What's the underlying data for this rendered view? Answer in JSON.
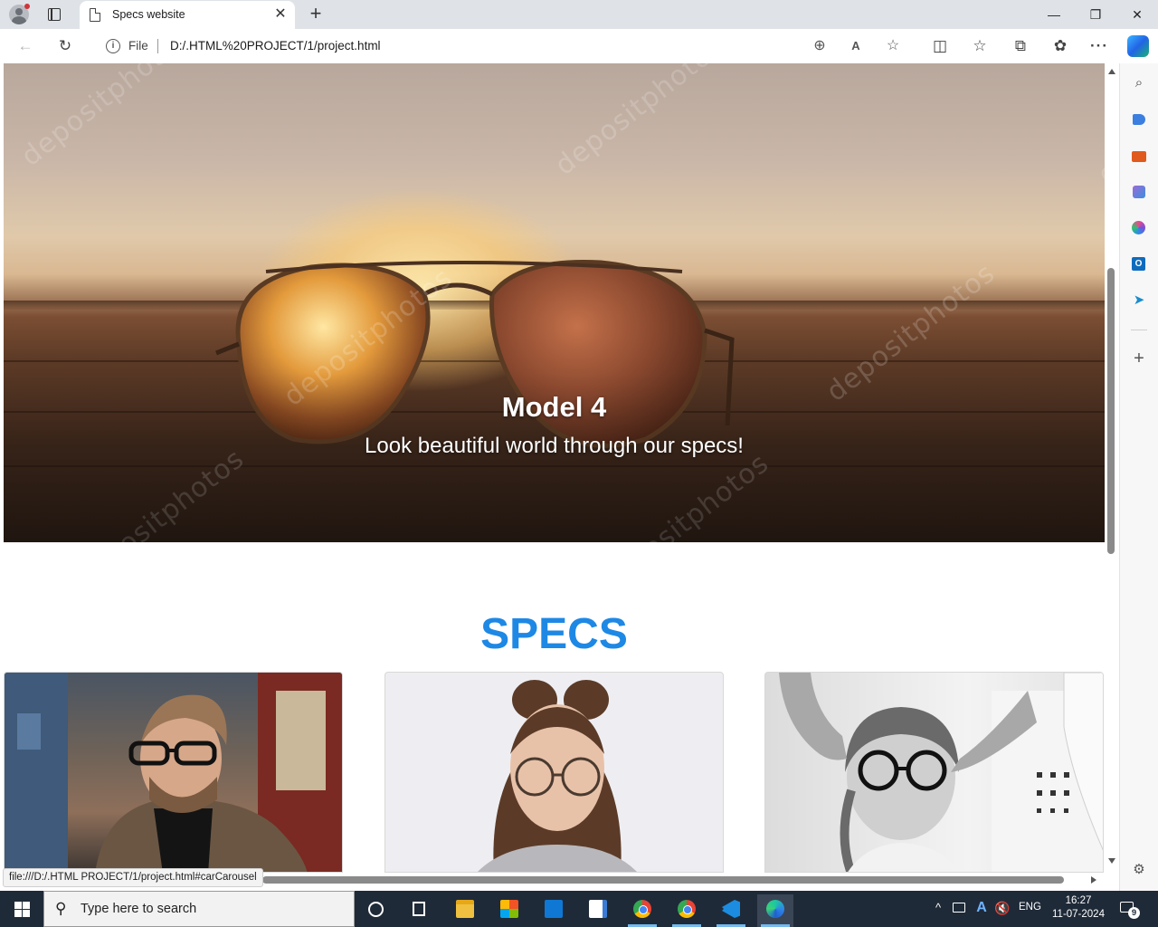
{
  "browser": {
    "tab_title": "Specs website",
    "tab_close_glyph": "✕",
    "new_tab_glyph": "+",
    "address": {
      "scheme_label": "File",
      "url": "D:/.HTML%20PROJECT/1/project.html"
    },
    "window_controls": {
      "minimize": "—",
      "restore": "❐",
      "close": "✕"
    },
    "toolbar_glyphs": {
      "back": "←",
      "reload": "↻",
      "zoom": "⊕",
      "read_aloud": "A",
      "favorite": "☆",
      "split_screen": "◫",
      "favorites": "☆",
      "collections": "⧉",
      "extensions": "✿",
      "more": "···"
    },
    "status_url": "file:///D:/.HTML PROJECT/1/project.html#carCarousel"
  },
  "sidebar": {
    "search_glyph": "⌕",
    "send_glyph": "➤",
    "add_glyph": "+",
    "settings_glyph": "⚙",
    "outlook_letter": "O"
  },
  "page": {
    "carousel": {
      "title": "Model 4",
      "text": "Look beautiful world through our specs!"
    },
    "specs_heading": "SPECS",
    "watermark": "depositphotos"
  },
  "taskbar": {
    "search_placeholder": "Type here to search",
    "search_glyph": "⚲",
    "tray": {
      "chevron": "^",
      "azure": "A",
      "volume": "🔇",
      "language": "ENG",
      "time": "16:27",
      "date": "11-07-2024",
      "notification_count": "9"
    }
  },
  "colors": {
    "accent_heading": "#1e88e5",
    "taskbar": "#1f2a38",
    "tab_strip": "#dfe3e8"
  }
}
